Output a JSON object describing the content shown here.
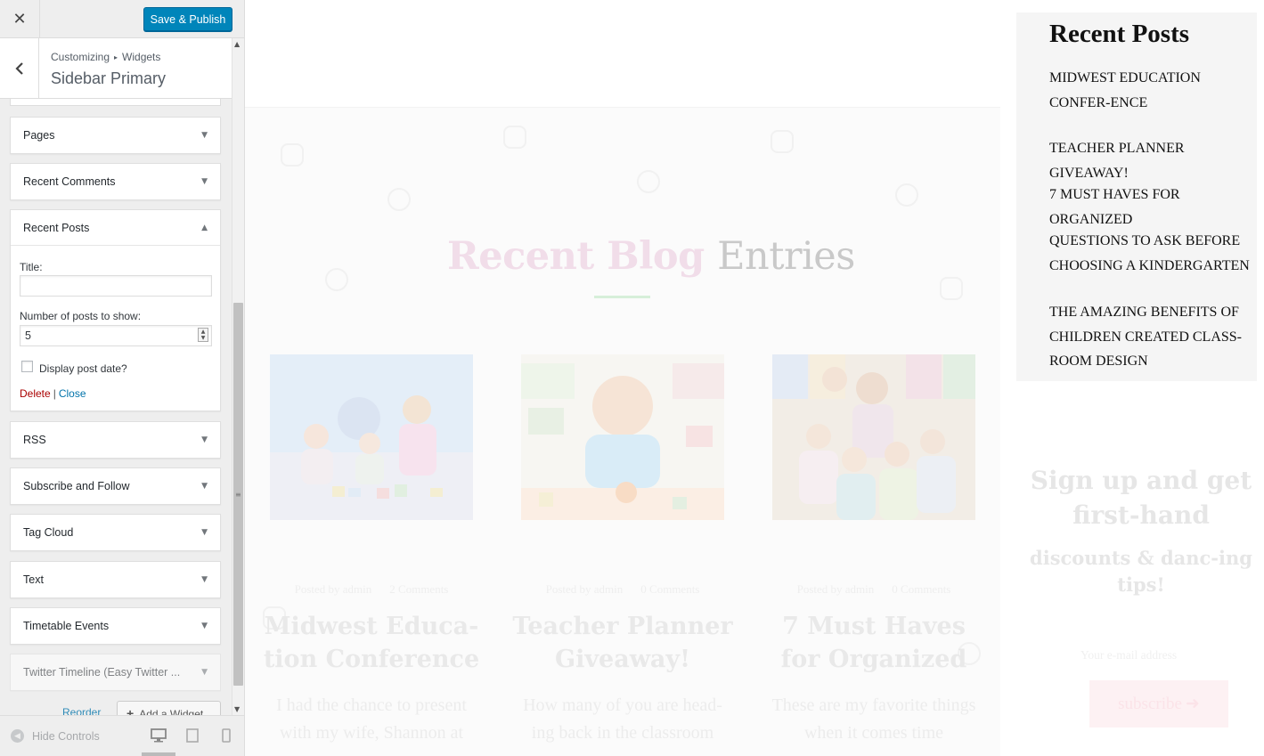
{
  "customizer": {
    "close_glyph": "✕",
    "save_label": "Save & Publish",
    "breadcrumb": [
      "Customizing",
      "Widgets"
    ],
    "breadcrumb_sep": "▸",
    "section_title": "Sidebar Primary",
    "widgets": {
      "pages": "Pages",
      "recent_comments": "Recent Comments",
      "recent_posts": "Recent Posts",
      "rss": "RSS",
      "subscribe": "Subscribe and Follow",
      "tag_cloud": "Tag Cloud",
      "text": "Text",
      "timetable": "Timetable Events",
      "twitter": "Twitter Timeline (Easy Twitter ..."
    },
    "recent_posts_form": {
      "title_label": "Title:",
      "title_value": "",
      "count_label": "Number of posts to show:",
      "count_value": "5",
      "show_date_label": "Display post date?",
      "show_date_checked": false,
      "delete_label": "Delete",
      "link_sep": "|",
      "close_label": "Close"
    },
    "reorder_label": "Reorder",
    "add_widget_label": "Add a Widget",
    "hide_controls_label": "Hide Controls",
    "arrow_down": "▼",
    "arrow_up": "▲"
  },
  "preview": {
    "blog_heading_1": "Recent Blog",
    "blog_heading_2": "Entries",
    "posts": [
      {
        "meta_author": "Posted by admin",
        "meta_comments": "2 Comments",
        "title": "Midwest Educa-tion Conference",
        "excerpt": "I had the chance to present with my wife, Shannon at"
      },
      {
        "meta_author": "Posted by admin",
        "meta_comments": "0 Comments",
        "title": "Teacher Planner Giveaway!",
        "excerpt": "How many of you are head-ing back in the classroom"
      },
      {
        "meta_author": "Posted by admin",
        "meta_comments": "0 Comments",
        "title": "7 Must Haves for Organized",
        "excerpt": "These are my favorite things when it comes time"
      }
    ],
    "sidebar_title": "Recent Posts",
    "sidebar_posts": [
      "MIDWEST EDUCATION CONFER-ENCE",
      "TEACHER PLANNER GIVEAWAY!",
      "7 MUST HAVES FOR ORGANIZED",
      "QUESTIONS TO ASK BEFORE CHOOSING A KINDERGARTEN",
      "THE AMAZING BENEFITS OF CHILDREN CREATED CLASS-ROOM DESIGN"
    ],
    "signup_title": "Sign up and get first-hand",
    "signup_sub": "discounts & danc-ing tips!",
    "signup_placeholder": "Your e-mail address",
    "signup_button": "subscribe"
  },
  "colors": {
    "primary_button": "#0085ba",
    "link": "#0073aa",
    "delete": "#aa0000"
  }
}
